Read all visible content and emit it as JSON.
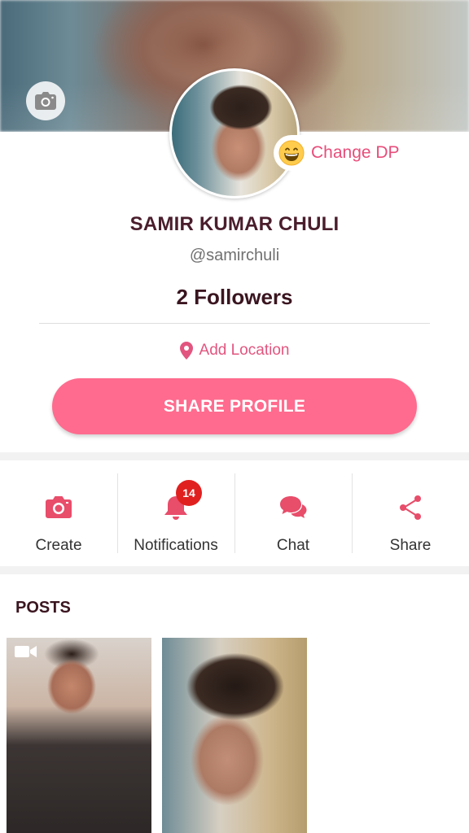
{
  "profile": {
    "change_dp_label": "Change DP",
    "name": "SAMIR KUMAR CHULI",
    "handle": "@samirchuli",
    "followers": "2 Followers",
    "add_location_label": "Add Location",
    "share_profile_label": "SHARE PROFILE"
  },
  "actions": [
    {
      "label": "Create",
      "icon": "camera-icon"
    },
    {
      "label": "Notifications",
      "icon": "bell-icon",
      "badge": "14"
    },
    {
      "label": "Chat",
      "icon": "chat-bubbles-icon"
    },
    {
      "label": "Share",
      "icon": "share-icon"
    }
  ],
  "posts": {
    "title": "POSTS",
    "items": [
      {
        "type": "video",
        "icon": "video-camera-icon"
      },
      {
        "type": "photo"
      }
    ]
  },
  "colors": {
    "accent": "#ff6b8e",
    "accent_text": "#e84d7a",
    "name_text": "#4a1d2c",
    "badge": "#e0201f"
  }
}
